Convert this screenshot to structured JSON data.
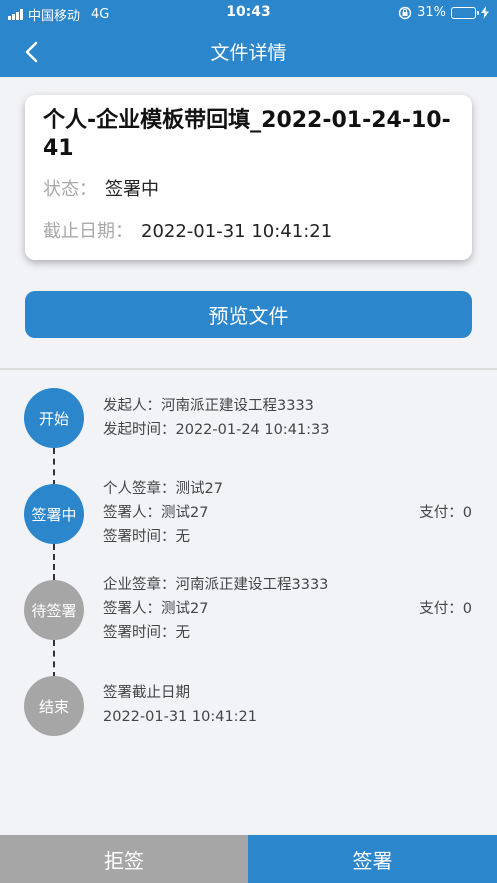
{
  "status_bar": {
    "carrier": "中国移动",
    "network": "4G",
    "time": "10:43",
    "battery": "31%",
    "battery_level": 0.31
  },
  "nav": {
    "title": "文件详情"
  },
  "document": {
    "title": "个人-企业模板带回填_2022-01-24-10-41",
    "status_label": "状态：",
    "status_value": "签署中",
    "deadline_label": "截止日期：",
    "deadline_value": "2022-01-31 10:41:21"
  },
  "preview_button": "预览文件",
  "timeline": {
    "start": {
      "node": "开始",
      "initiator_label": "发起人：",
      "initiator_value": "河南派正建设工程3333",
      "time_label": "发起时间：",
      "time_value": "2022-01-24 10:41:33"
    },
    "signing": {
      "node": "签署中",
      "seal_label": "个人签章：",
      "seal_value": "测试27",
      "signer_label": "签署人：",
      "signer_value": "测试27",
      "time_label": "签署时间：",
      "time_value": "无",
      "pay_label": "支付：",
      "pay_value": "0"
    },
    "pending": {
      "node": "待签署",
      "seal_label": "企业签章：",
      "seal_value": "河南派正建设工程3333",
      "signer_label": "签署人：",
      "signer_value": "测试27",
      "time_label": "签署时间：",
      "time_value": "无",
      "pay_label": "支付：",
      "pay_value": "0"
    },
    "end": {
      "node": "结束",
      "deadline_label": "签署截止日期",
      "deadline_value": "2022-01-31 10:41:21"
    }
  },
  "footer": {
    "reject": "拒签",
    "sign": "签署"
  },
  "colors": {
    "primary": "#2b86cc",
    "gray": "#a6a6a6",
    "battery": "#f7c948"
  }
}
